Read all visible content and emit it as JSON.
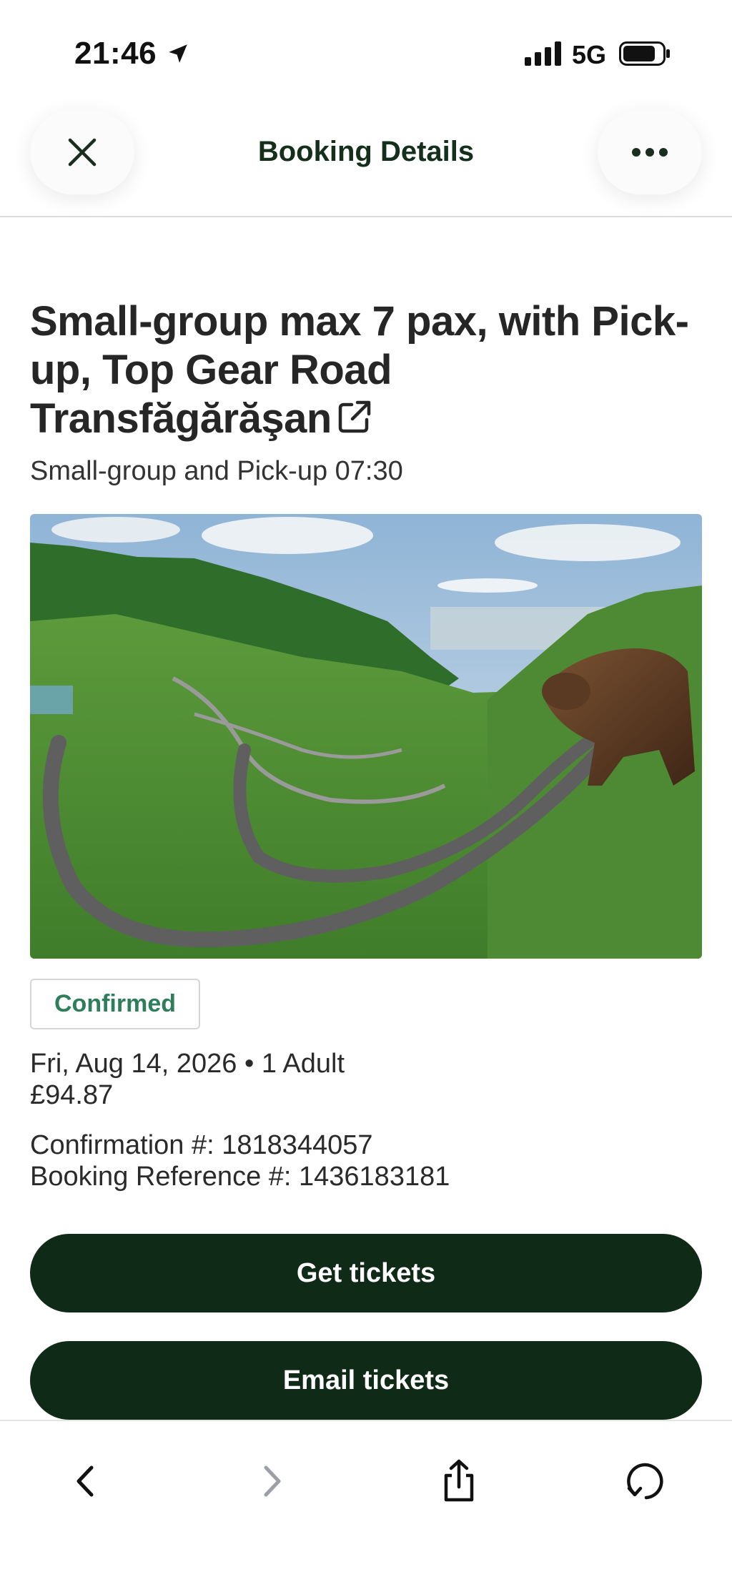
{
  "status_bar": {
    "time": "21:46",
    "network": "5G",
    "icons": [
      "location-arrow-icon",
      "signal-icon",
      "battery-icon"
    ]
  },
  "header": {
    "title": "Booking Details",
    "close_icon": "close-icon",
    "more_icon": "more-icon"
  },
  "booking": {
    "title": "Small-group max 7 pax, with Pick-up, Top Gear Road Transfăgărăşan",
    "subtitle": "Small-group and Pick-up 07:30",
    "status": "Confirmed",
    "date_guests": "Fri, Aug 14, 2026 • 1 Adult",
    "price": "£94.87",
    "confirmation": "Confirmation #: 1818344057",
    "booking_reference": "Booking Reference #: 1436183181"
  },
  "actions": {
    "get_tickets": "Get tickets",
    "email_tickets": "Email tickets"
  },
  "toolbar": {
    "icons": [
      "back-icon",
      "forward-icon",
      "share-icon",
      "reload-icon"
    ]
  },
  "colors": {
    "primary_dark": "#102a18",
    "confirmed_green": "#2e7d5b",
    "header_title": "#14301c"
  }
}
